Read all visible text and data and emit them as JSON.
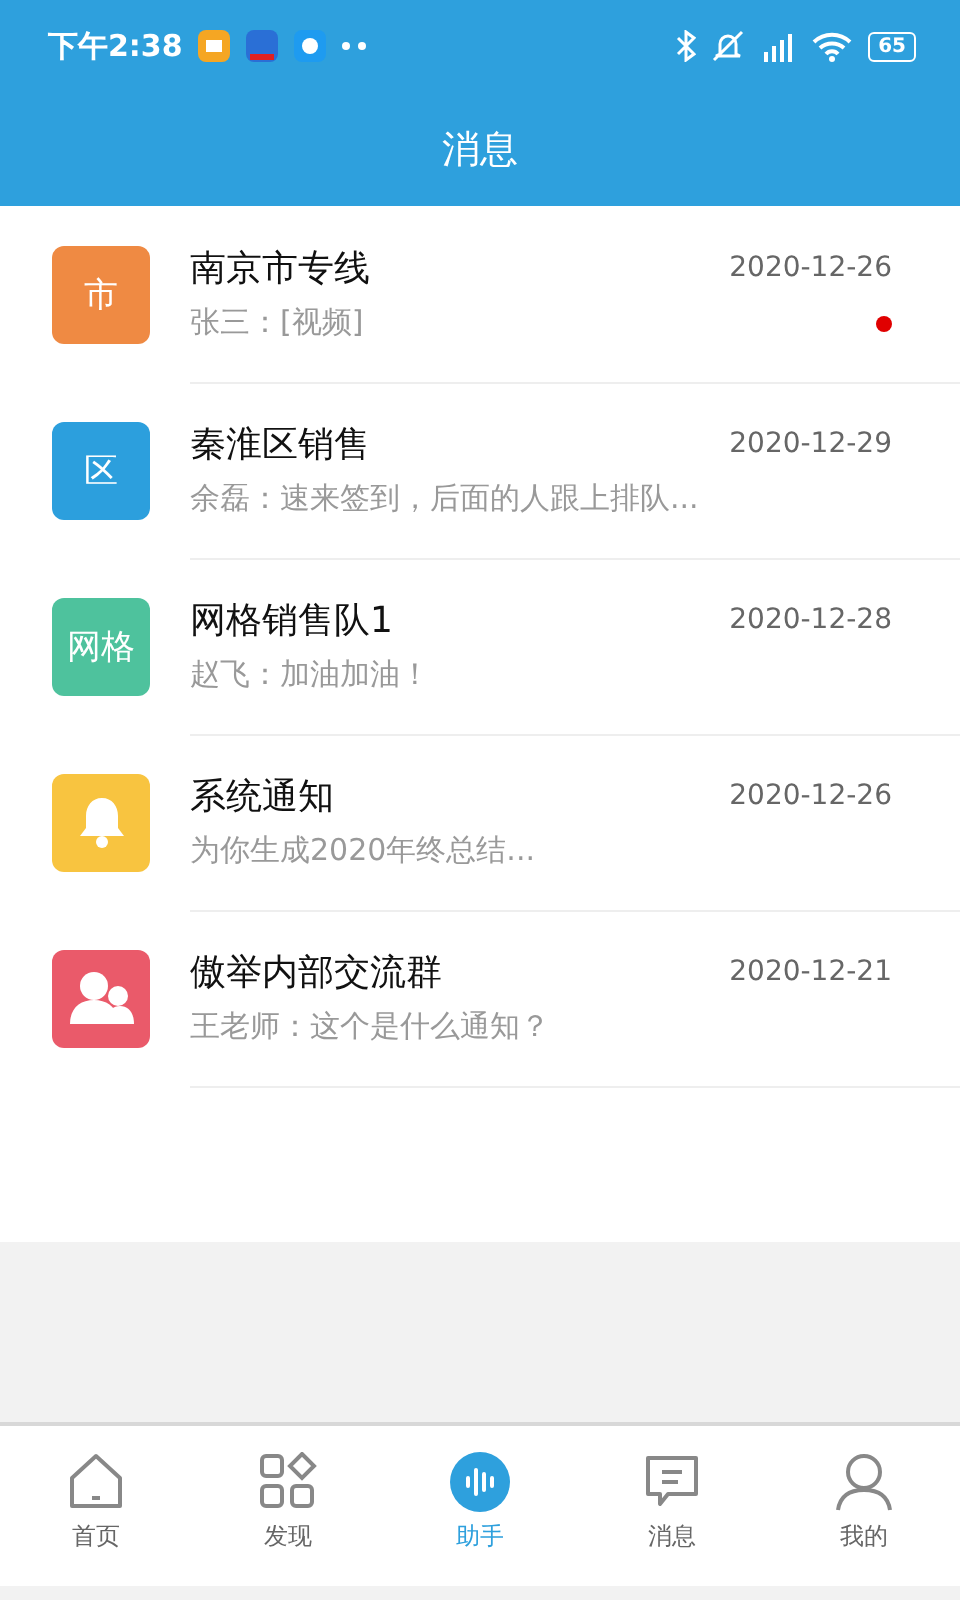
{
  "status_bar": {
    "time": "下午2:38",
    "battery": "65"
  },
  "header": {
    "title": "消息"
  },
  "conversations": [
    {
      "avatar": {
        "kind": "text",
        "text": "市",
        "color": "#ef8a43"
      },
      "name": "南京市专线",
      "preview": "张三：[视频]",
      "date": "2020-12-26",
      "unread": true
    },
    {
      "avatar": {
        "kind": "text",
        "text": "区",
        "color": "#2c9fdd"
      },
      "name": "秦淮区销售",
      "preview": "余磊：速来签到，后面的人跟上排队...",
      "date": "2020-12-29",
      "unread": false
    },
    {
      "avatar": {
        "kind": "text",
        "text": "网格",
        "color": "#4ec29d"
      },
      "name": "网格销售队1",
      "preview": "赵飞：加油加油！",
      "date": "2020-12-28",
      "unread": false
    },
    {
      "avatar": {
        "kind": "bell",
        "color": "#f8c440"
      },
      "name": "系统通知",
      "preview": "为你生成2020年终总结...",
      "date": "2020-12-26",
      "unread": false
    },
    {
      "avatar": {
        "kind": "group",
        "color": "#ea5a6a"
      },
      "name": "傲举内部交流群",
      "preview": "王老师：这个是什么通知？",
      "date": "2020-12-21",
      "unread": false
    }
  ],
  "tabs": [
    {
      "kind": "home",
      "label": "首页",
      "selected": false
    },
    {
      "kind": "discover",
      "label": "发现",
      "selected": false
    },
    {
      "kind": "assistant",
      "label": "助手",
      "selected": true
    },
    {
      "kind": "message",
      "label": "消息",
      "selected": false
    },
    {
      "kind": "profile",
      "label": "我的",
      "selected": false
    }
  ]
}
